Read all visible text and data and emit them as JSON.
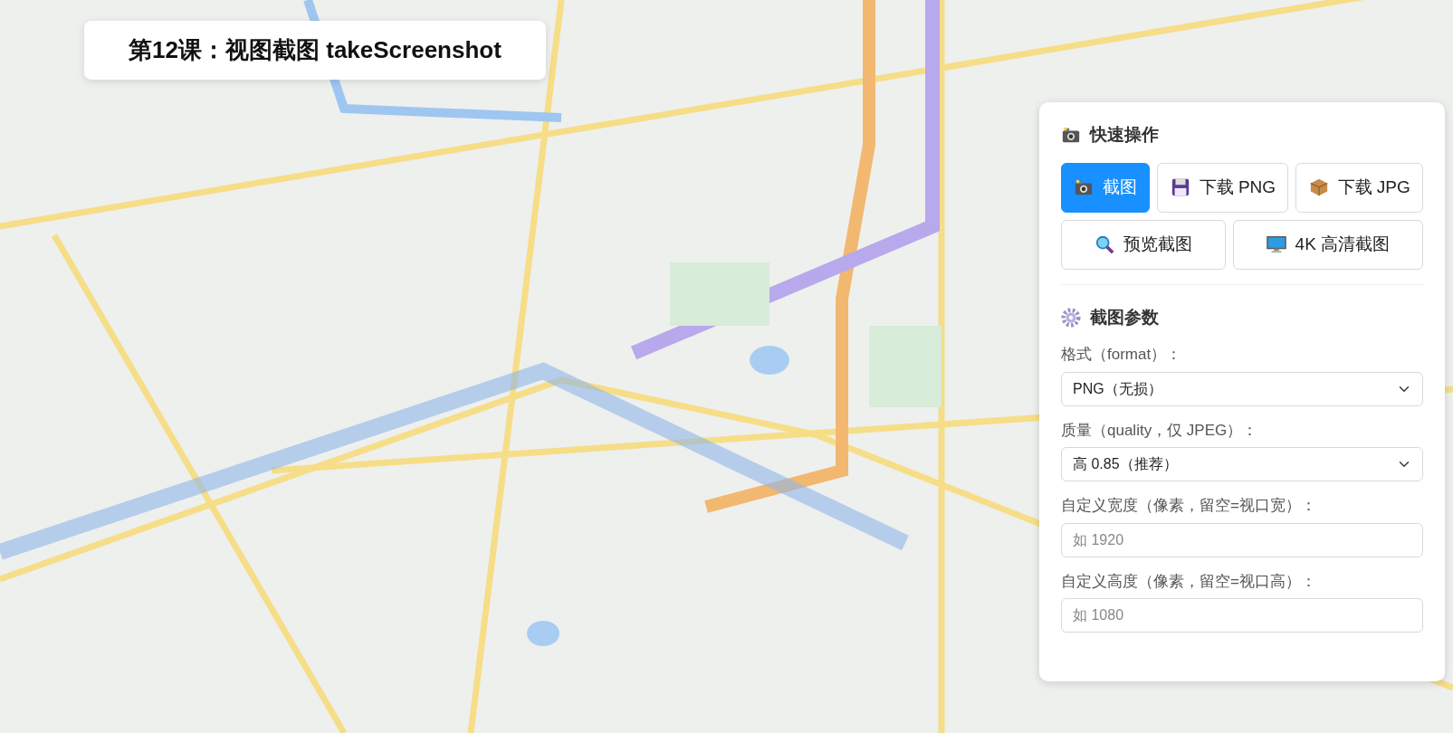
{
  "title_card": {
    "text": "第12课：视图截图 takeScreenshot"
  },
  "panel": {
    "quick_section": {
      "heading": "快速操作"
    },
    "button_rows": [
      [
        {
          "label": "截图",
          "kind": "primary"
        },
        {
          "label": "下载 PNG",
          "kind": "default"
        },
        {
          "label": "下载 JPG",
          "kind": "default"
        }
      ],
      [
        {
          "label": "预览截图",
          "kind": "default"
        },
        {
          "label": "4K 高清截图",
          "kind": "default"
        }
      ]
    ],
    "params_section": {
      "heading": "截图参数"
    },
    "fields": [
      {
        "kind": "select",
        "label": "格式（format）：",
        "value": "PNG（无损）"
      },
      {
        "kind": "select",
        "label": "质量（quality，仅 JPEG）：",
        "value": "高 0.85（推荐）"
      },
      {
        "kind": "input",
        "label": "自定义宽度（像素，留空=视口宽）：",
        "placeholder": "如 1920"
      },
      {
        "kind": "input",
        "label": "自定义高度（像素，留空=视口高）：",
        "placeholder": "如 1080"
      }
    ]
  }
}
